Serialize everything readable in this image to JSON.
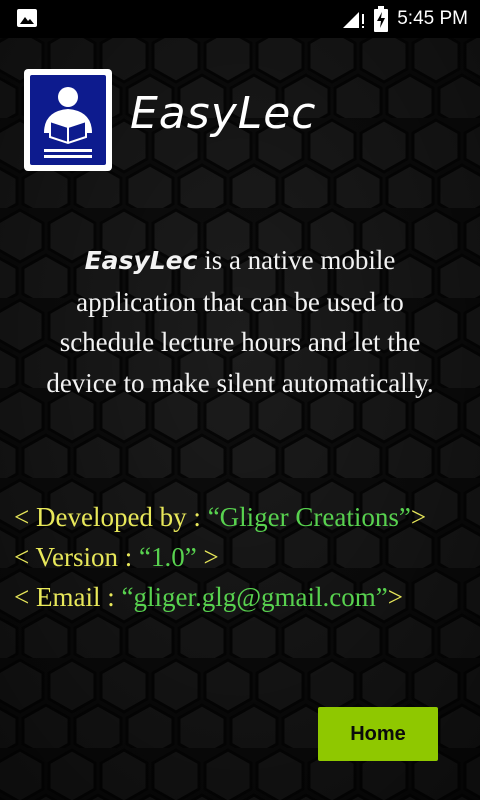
{
  "status_bar": {
    "time": "5:45 PM",
    "left_icon": "image-icon",
    "icons": [
      "signal-icon",
      "battery-charging-icon"
    ]
  },
  "app": {
    "name": "EasyLec",
    "logo_icon": "reading-person-icon"
  },
  "description": {
    "brand": "EasyLec",
    "text": " is a native mobile application that can be used to schedule lecture hours and let the device to make silent automatically."
  },
  "info": {
    "developer_label": "< Developed by : ",
    "developer_value": "“Gliger Creations”",
    "developer_end": ">",
    "version_label": "< Version : ",
    "version_value": "“1.0”",
    "version_end": " >",
    "email_label": "< Email : ",
    "email_value": "“gliger.glg@gmail.com”",
    "email_end": ">"
  },
  "home_button": {
    "label": "Home"
  },
  "colors": {
    "label_yellow": "#e8e85a",
    "value_green": "#58d24f",
    "button_green": "#8fc800",
    "logo_blue": "#0d1b8e"
  }
}
